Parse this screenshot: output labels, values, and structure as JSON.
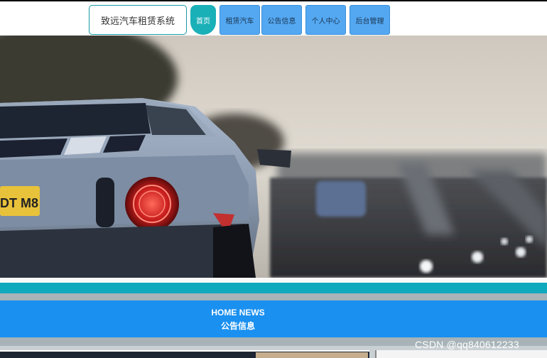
{
  "header": {
    "brand": "致远汽车租赁系统",
    "nav": [
      {
        "label": "首页"
      },
      {
        "label": "租赁汽车"
      },
      {
        "label": "公告信息"
      },
      {
        "label": "个人中心"
      },
      {
        "label": "后台管理"
      }
    ]
  },
  "hero": {
    "plate_text": "DT M8"
  },
  "news_section": {
    "title_en": "HOME NEWS",
    "title_cn": "公告信息"
  },
  "watermark": "CSDN @qq840612233",
  "colors": {
    "teal": "#10a9bd",
    "nav_blue": "#54a8f2",
    "news_blue": "#1a90f0"
  }
}
